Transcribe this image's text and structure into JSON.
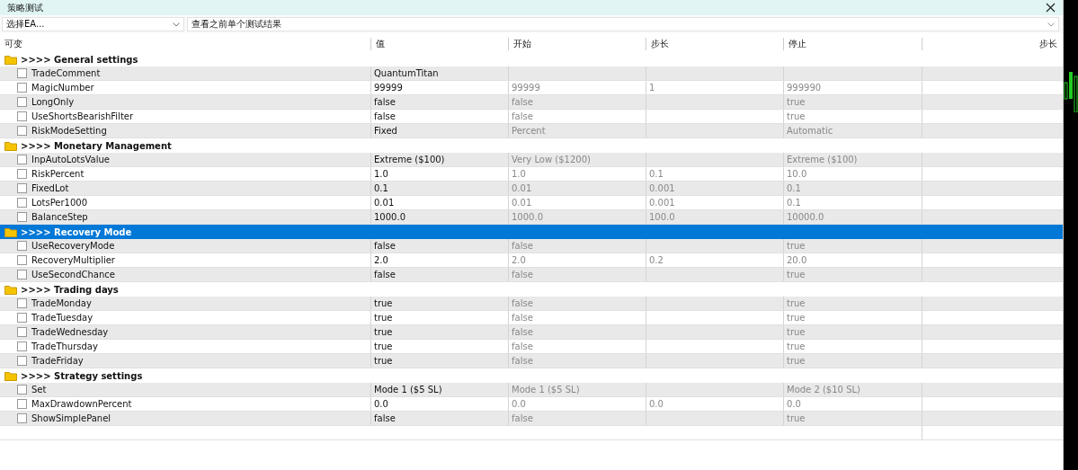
{
  "window": {
    "title": "策略测试"
  },
  "ea_select": {
    "value": "选择EA..."
  },
  "results_select": {
    "value": "查看之前单个测试结果"
  },
  "table": {
    "columns": [
      "可变",
      "值",
      "开始",
      "步长",
      "停止",
      "步长"
    ],
    "groups": [
      {
        "name": ">>>> General settings",
        "selected": false,
        "params": [
          {
            "name": "TradeComment",
            "checked": false,
            "value": "QuantumTitan"
          },
          {
            "name": "MagicNumber",
            "checked": false,
            "value": "99999",
            "start": "99999",
            "step": "1",
            "stop": "999990"
          },
          {
            "name": "LongOnly",
            "checked": false,
            "value": "false",
            "start": "false",
            "stop": "true"
          },
          {
            "name": "UseShortsBearishFilter",
            "checked": false,
            "value": "false",
            "start": "false",
            "stop": "true"
          },
          {
            "name": "RiskModeSetting",
            "checked": false,
            "value": "Fixed",
            "start": "Percent",
            "stop": "Automatic"
          }
        ]
      },
      {
        "name": ">>>> Monetary Management",
        "selected": false,
        "params": [
          {
            "name": "InpAutoLotsValue",
            "checked": false,
            "value": "Extreme ($100)",
            "start": "Very Low ($1200)",
            "stop": "Extreme ($100)"
          },
          {
            "name": "RiskPercent",
            "checked": false,
            "value": "1.0",
            "start": "1.0",
            "step": "0.1",
            "stop": "10.0"
          },
          {
            "name": "FixedLot",
            "checked": false,
            "value": "0.1",
            "start": "0.01",
            "step": "0.001",
            "stop": "0.1"
          },
          {
            "name": "LotsPer1000",
            "checked": false,
            "value": "0.01",
            "start": "0.01",
            "step": "0.001",
            "stop": "0.1"
          },
          {
            "name": "BalanceStep",
            "checked": false,
            "value": "1000.0",
            "start": "1000.0",
            "step": "100.0",
            "stop": "10000.0"
          }
        ]
      },
      {
        "name": ">>>> Recovery Mode",
        "selected": true,
        "params": [
          {
            "name": "UseRecoveryMode",
            "checked": false,
            "value": "false",
            "start": "false",
            "stop": "true"
          },
          {
            "name": "RecoveryMultiplier",
            "checked": false,
            "value": "2.0",
            "start": "2.0",
            "step": "0.2",
            "stop": "20.0"
          },
          {
            "name": "UseSecondChance",
            "checked": false,
            "value": "false",
            "start": "false",
            "stop": "true"
          }
        ]
      },
      {
        "name": ">>>> Trading days",
        "selected": false,
        "params": [
          {
            "name": "TradeMonday",
            "checked": false,
            "value": "true",
            "start": "false",
            "stop": "true"
          },
          {
            "name": "TradeTuesday",
            "checked": false,
            "value": "true",
            "start": "false",
            "stop": "true"
          },
          {
            "name": "TradeWednesday",
            "checked": false,
            "value": "true",
            "start": "false",
            "stop": "true"
          },
          {
            "name": "TradeThursday",
            "checked": false,
            "value": "true",
            "start": "false",
            "stop": "true"
          },
          {
            "name": "TradeFriday",
            "checked": false,
            "value": "true",
            "start": "false",
            "stop": "true"
          }
        ]
      },
      {
        "name": ">>>> Strategy settings",
        "selected": false,
        "params": [
          {
            "name": "Set",
            "checked": false,
            "value": "Mode 1 ($5 SL)",
            "start": "Mode 1 ($5 SL)",
            "stop": "Mode 2 ($10 SL)"
          },
          {
            "name": "MaxDrawdownPercent",
            "checked": false,
            "value": "0.0",
            "start": "0.0",
            "step": "0.0",
            "stop": "0.0"
          },
          {
            "name": "ShowSimplePanel",
            "checked": false,
            "value": "false",
            "start": "false",
            "stop": "true"
          }
        ]
      }
    ]
  }
}
